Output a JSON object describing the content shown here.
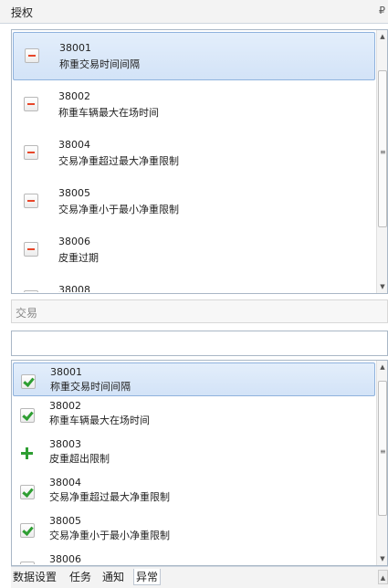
{
  "window": {
    "title": "授权",
    "pin_glyph": "₽"
  },
  "auth_list": {
    "items": [
      {
        "code": "38001",
        "name": "称重交易时间间隔",
        "icon": "minus-icon",
        "selected": true
      },
      {
        "code": "38002",
        "name": "称重车辆最大在场时间",
        "icon": "minus-icon",
        "selected": false
      },
      {
        "code": "38004",
        "name": "交易净重超过最大净重限制",
        "icon": "minus-icon",
        "selected": false
      },
      {
        "code": "38005",
        "name": "交易净重小于最小净重限制",
        "icon": "minus-icon",
        "selected": false
      },
      {
        "code": "38006",
        "name": "皮重过期",
        "icon": "minus-icon",
        "selected": false
      },
      {
        "code": "38008",
        "name": "",
        "icon": "minus-icon",
        "selected": false
      }
    ]
  },
  "transaction_section": {
    "label": "交易",
    "search": {
      "value": "",
      "placeholder": ""
    }
  },
  "transaction_list": {
    "items": [
      {
        "code": "38001",
        "name": "称重交易时间间隔",
        "icon": "check-icon",
        "selected": true
      },
      {
        "code": "38002",
        "name": "称重车辆最大在场时间",
        "icon": "check-icon",
        "selected": false
      },
      {
        "code": "38003",
        "name": "皮重超出限制",
        "icon": "plus-icon",
        "selected": false
      },
      {
        "code": "38004",
        "name": "交易净重超过最大净重限制",
        "icon": "check-icon",
        "selected": false
      },
      {
        "code": "38005",
        "name": "交易净重小于最小净重限制",
        "icon": "check-icon",
        "selected": false
      },
      {
        "code": "38006",
        "name": "",
        "icon": "check-icon",
        "selected": false
      }
    ]
  },
  "tabs": [
    {
      "label": "数据设置",
      "active": false
    },
    {
      "label": "任务",
      "active": false
    },
    {
      "label": "通知",
      "active": false
    },
    {
      "label": "异常",
      "active": true
    }
  ],
  "colors": {
    "accent_selected": "#d3e3f7",
    "minus_red": "#e8472a",
    "check_green": "#2e9e32",
    "border": "#a9b7c6"
  }
}
